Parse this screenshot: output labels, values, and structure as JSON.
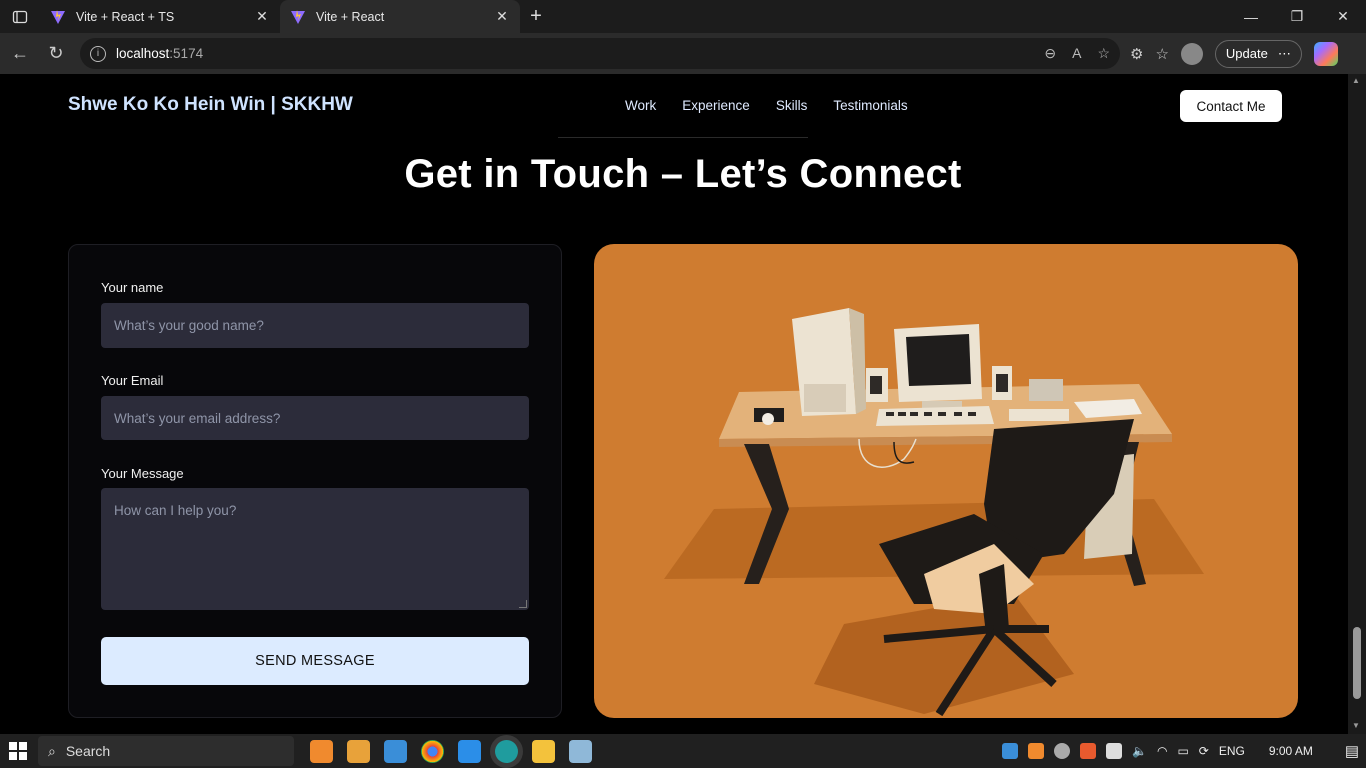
{
  "browser": {
    "tabs": [
      {
        "title": "Vite + React + TS",
        "active": false
      },
      {
        "title": "Vite + React",
        "active": true
      }
    ],
    "address": {
      "host": "localhost",
      "port": ":5174"
    },
    "update_label": "Update"
  },
  "site": {
    "brand": "Shwe Ko Ko Hein Win | SKKHW",
    "nav": [
      "Work",
      "Experience",
      "Skills",
      "Testimonials"
    ],
    "contact_button": "Contact Me",
    "heading": "Get in Touch – Let’s Connect"
  },
  "form": {
    "name_label": "Your name",
    "name_placeholder": "What’s your good name?",
    "email_label": "Your Email",
    "email_placeholder": "What’s your email address?",
    "message_label": "Your Message",
    "message_placeholder": "How can I help you?",
    "submit_label": "SEND MESSAGE"
  },
  "taskbar": {
    "search_label": "Search",
    "language": "ENG",
    "time": "9:00 AM"
  },
  "colors": {
    "scene_bg": "#cf7c30",
    "field_bg": "#2c2c3a",
    "send_bg": "#dcebff",
    "brand_text": "#cfe3ff"
  }
}
